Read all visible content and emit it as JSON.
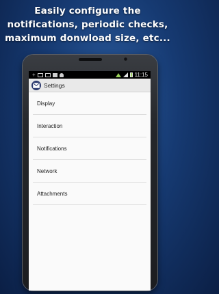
{
  "promo": {
    "line1": "Easily configure the",
    "line2": "notifications, periodic checks,",
    "line3": "maximum donwload size, etc..."
  },
  "statusbar": {
    "time": "11:15",
    "left_icons": [
      "add-icon",
      "mail-icon",
      "mail-icon",
      "image-icon",
      "fingerprint-icon"
    ],
    "right_icons": [
      "wifi-icon",
      "signal-icon",
      "battery-icon"
    ]
  },
  "actionbar": {
    "title": "Settings",
    "icon": "envelope-icon"
  },
  "settings": {
    "items": [
      {
        "label": "Display"
      },
      {
        "label": "Interaction"
      },
      {
        "label": "Notifications"
      },
      {
        "label": "Network"
      },
      {
        "label": "Attachments"
      }
    ]
  },
  "colors": {
    "background": "#163a72",
    "status_accent": "#9bd35a",
    "actionbar": "#e9e9e9",
    "app_icon": "#2c3a6e"
  }
}
